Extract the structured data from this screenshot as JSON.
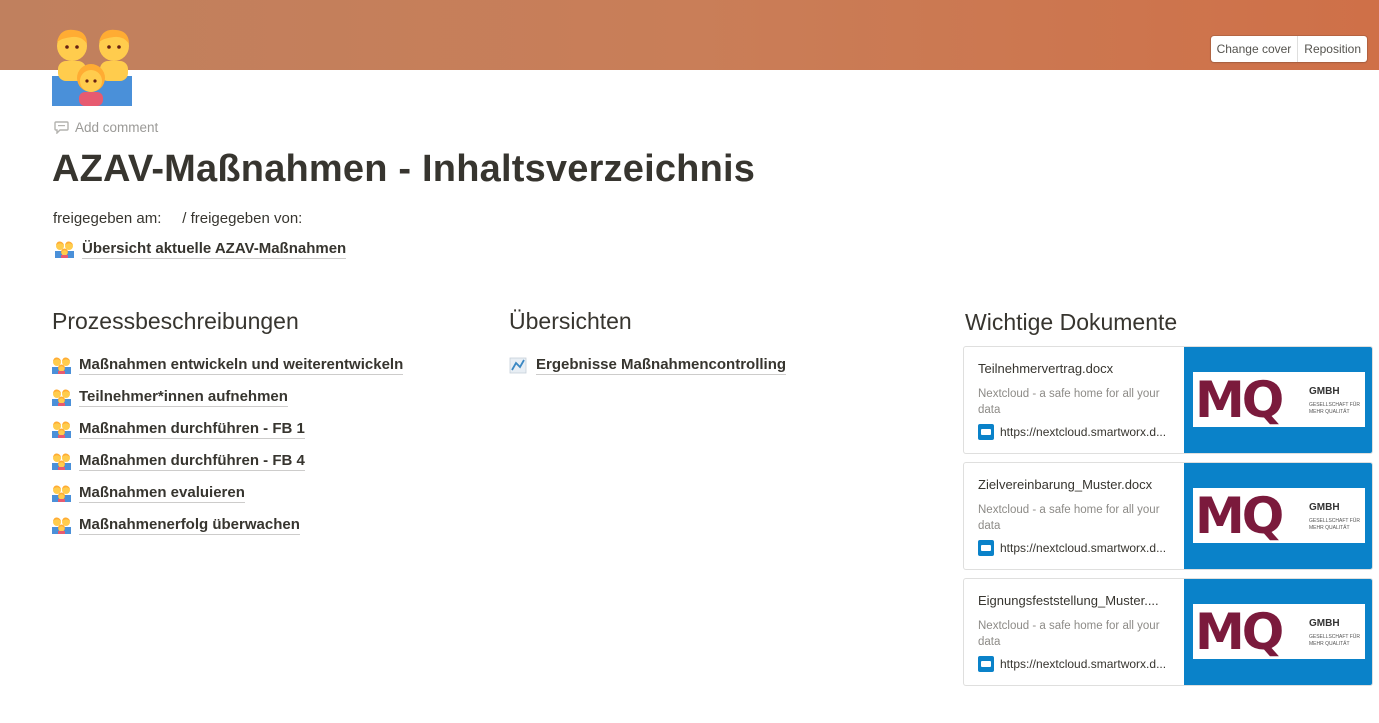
{
  "cover": {
    "change_cover_label": "Change cover",
    "reposition_label": "Reposition"
  },
  "page": {
    "icon": "family-emoji-icon",
    "add_comment_label": "Add comment",
    "title": "AZAV-Maßnahmen - Inhaltsverzeichnis",
    "meta": "freigegeben am:     / freigegeben von:",
    "top_link": "Übersicht aktuelle AZAV-Maßnahmen"
  },
  "columns": {
    "prozess": {
      "heading": "Prozessbeschreibungen",
      "items": [
        "Maßnahmen entwickeln und weiterentwickeln",
        "Teilnehmer*innen aufnehmen",
        "Maßnahmen durchführen - FB 1",
        "Maßnahmen durchführen - FB 4",
        "Maßnahmen evaluieren",
        "Maßnahmenerfolg überwachen"
      ]
    },
    "uebersichten": {
      "heading": "Übersichten",
      "items": [
        "Ergebnisse Maßnahmencontrolling"
      ]
    },
    "dokumente": {
      "heading": "Wichtige Dokumente",
      "bookmarks": [
        {
          "title": "Teilnehmervertrag.docx",
          "description": "Nextcloud - a safe home for all your data",
          "url": "https://nextcloud.smartworx.d..."
        },
        {
          "title": "Zielvereinbarung_Muster.docx",
          "description": "Nextcloud - a safe home for all your data",
          "url": "https://nextcloud.smartworx.d..."
        },
        {
          "title": "Eignungsfeststellung_Muster....",
          "description": "Nextcloud - a safe home for all your data",
          "url": "https://nextcloud.smartworx.d..."
        }
      ],
      "logo_text": "MQ",
      "logo_gmbh": "GMBH",
      "logo_sub": "GESELLSCHAFT FÜR MEHR QUALITÄT"
    }
  },
  "colors": {
    "cover_start": "#c0805e",
    "cover_end": "#cf7048",
    "bookmark_image_bg": "#0a82c9",
    "logo_color": "#7b1a3c"
  }
}
